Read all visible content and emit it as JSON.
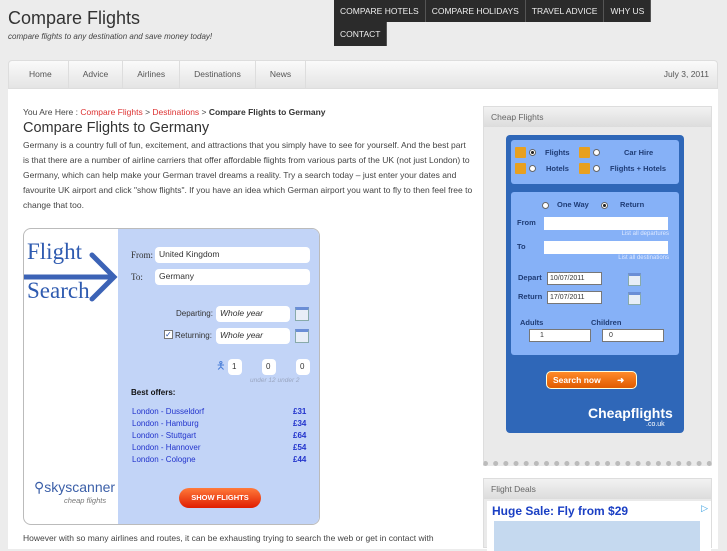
{
  "site": {
    "title": "Compare Flights",
    "tagline": "compare flights to any destination and save money today!"
  },
  "top_nav": [
    "COMPARE HOTELS",
    "COMPARE HOLIDAYS",
    "TRAVEL ADVICE",
    "WHY US",
    "CONTACT"
  ],
  "main_nav": {
    "items": [
      "Home",
      "Advice",
      "Airlines",
      "Destinations",
      "News"
    ],
    "date": "July 3, 2011"
  },
  "breadcrumb": {
    "prefix": "You Are Here : ",
    "items": [
      "Compare Flights",
      "Destinations"
    ],
    "sep": " > ",
    "current": "Compare Flights to Germany"
  },
  "page": {
    "heading": "Compare Flights to Germany",
    "intro": "Germany is a country full of fun, excitement, and attractions that you simply have to see for yourself. And the best part is that there are a number of airline carriers that offer affordable flights from various parts of the UK (not just London) to Germany, which can help make your German travel dreams a reality. Try a search today – just enter your dates and favourite UK airport and click \"show flights\". If you have an idea which German airport you want to fly to then feel free to change that too.",
    "bottom": "However with so many airlines and routes, it can be exhausting trying to search the web or get in contact with"
  },
  "skyscanner": {
    "logo_line1": "Flight",
    "logo_line2": "Search",
    "from_label": "From:",
    "from_value": "United Kingdom",
    "to_label": "To:",
    "to_value": "Germany",
    "departing_label": "Departing:",
    "departing_value": "Whole year",
    "returning_label": "Returning:",
    "returning_value": "Whole year",
    "returning_checked": true,
    "adults": "1",
    "children": "0",
    "infants": "0",
    "under12": "under 12",
    "under2": "under 2",
    "best_offers_label": "Best offers:",
    "offers": [
      {
        "route": "London - Dusseldorf",
        "price": "£31"
      },
      {
        "route": "London - Hamburg",
        "price": "£34"
      },
      {
        "route": "London - Stuttgart",
        "price": "£64"
      },
      {
        "route": "London - Hannover",
        "price": "£54"
      },
      {
        "route": "London - Cologne",
        "price": "£44"
      }
    ],
    "brand": "skyscanner",
    "brand_sub": "cheap flights",
    "button": "SHOW FLIGHTS"
  },
  "sidebar": {
    "cheap_flights_title": "Cheap Flights",
    "flight_deals_title": "Flight Deals",
    "ad_headline": "Huge Sale: Fly from $29"
  },
  "cheapflights": {
    "tabs": [
      "Flights",
      "Car Hire",
      "Hotels",
      "Flights + Hotels"
    ],
    "selected_tab": "Flights",
    "trip_types": [
      "One Way",
      "Return"
    ],
    "selected_trip": "Return",
    "from_label": "From",
    "to_label": "To",
    "list_departures": "List all departures",
    "list_destinations": "List all destinations",
    "depart_label": "Depart",
    "depart_value": "10/07/2011",
    "return_label": "Return",
    "return_value": "17/07/2011",
    "adults_label": "Adults",
    "adults_value": "1",
    "children_label": "Children",
    "children_value": "0",
    "button": "Search now",
    "brand": "Cheapflights",
    "brand_sub": ".co.uk"
  }
}
